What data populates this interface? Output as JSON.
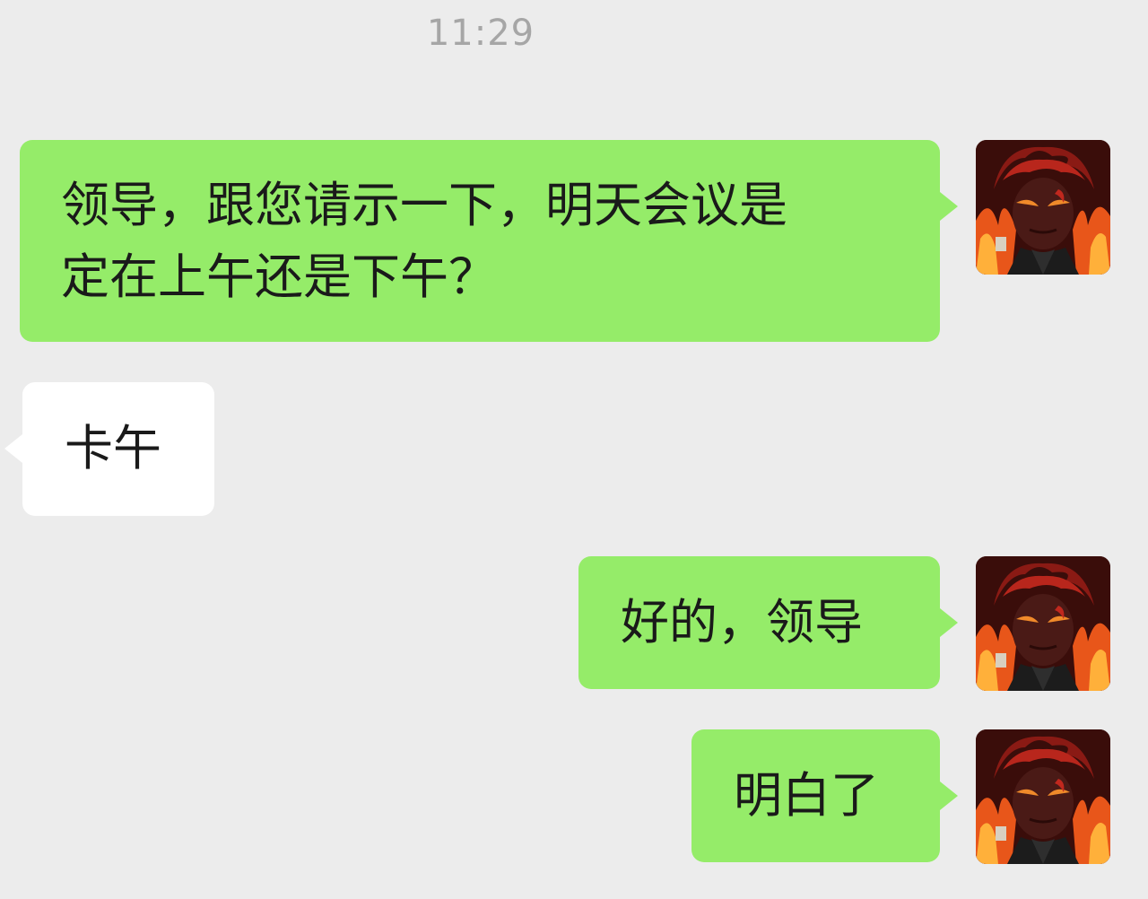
{
  "header": {
    "timestamp": "11:29"
  },
  "messages": [
    {
      "side": "sent",
      "lines": [
        "领导，跟您请示一下，明天会议是",
        "定在上午还是下午？"
      ],
      "avatar_icon": "user-avatar-icon"
    },
    {
      "side": "received",
      "lines": [
        "卡午"
      ]
    },
    {
      "side": "sent",
      "lines": [
        "好的，领导"
      ],
      "avatar_icon": "user-avatar-icon"
    },
    {
      "side": "sent",
      "lines": [
        "明白了"
      ],
      "avatar_icon": "user-avatar-icon"
    }
  ],
  "colors": {
    "background": "#ececec",
    "sent_bubble": "#95ec69",
    "received_bubble": "#ffffff",
    "timestamp_text": "#a6a6a6",
    "message_text": "#1a1a1a"
  }
}
